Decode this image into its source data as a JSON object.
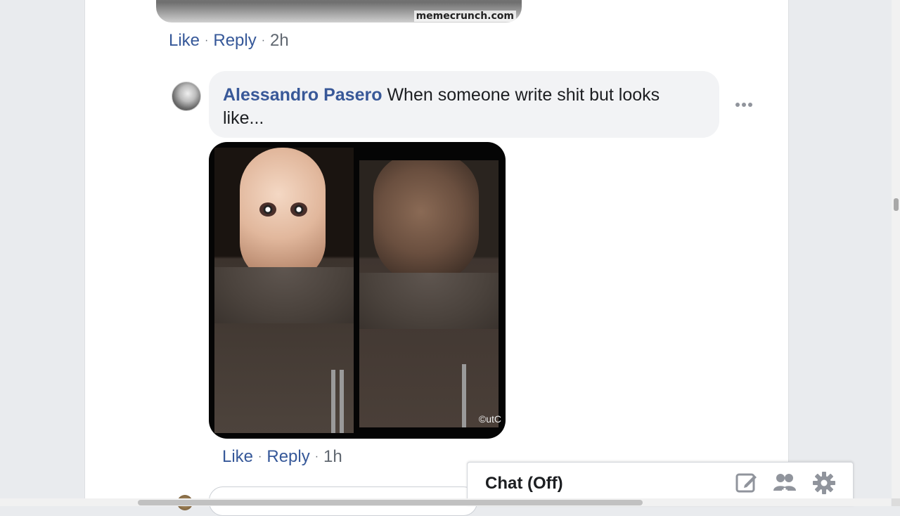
{
  "previous_comment": {
    "image_watermark": "memecrunch.com",
    "actions": {
      "like": "Like",
      "reply": "Reply",
      "separator": "·",
      "time": "2h"
    }
  },
  "comment": {
    "author": "Alessandro Pasero",
    "text": "When someone write shit but looks like...",
    "image_watermark": "©utC",
    "actions": {
      "like": "Like",
      "reply": "Reply",
      "separator": "·",
      "time": "1h"
    }
  },
  "chat": {
    "label": "Chat (Off)",
    "icons": [
      "compose-icon",
      "friends-icon",
      "settings-gear-icon"
    ]
  },
  "colors": {
    "link": "#385898",
    "meta": "#606770",
    "bubble": "#f2f3f5",
    "background": "#e9ebee"
  }
}
